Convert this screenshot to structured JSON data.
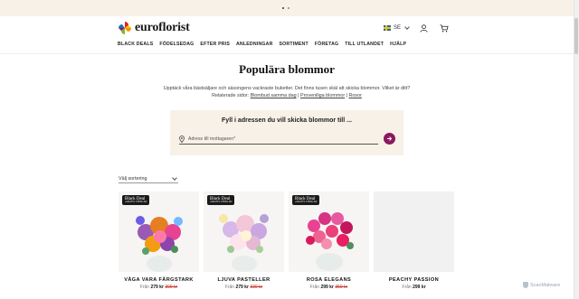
{
  "topbar": {
    "indicator_count": 2
  },
  "header": {
    "logo_text": "euroflorist",
    "language": "SE",
    "nav": [
      "BLACK DEALS",
      "FÖDELSEDAG",
      "EFTER PRIS",
      "ANLEDNINGAR",
      "SORTIMENT",
      "FÖRETAG",
      "TILL UTLANDET",
      "HJÄLP"
    ]
  },
  "page": {
    "title": "Populära blommor",
    "intro": "Upptäck våra bästsäljare och säsongens vackraste buketter. Det finns tusen skäl att skicka blommor. Vilket är ditt?",
    "related_label": "Relaterade sidor:",
    "related_links": [
      "Blombud samma dag",
      "Proveniliga blommor",
      "Rosor"
    ],
    "related_sep": "|"
  },
  "address": {
    "heading": "Fyll i adressen du vill skicka blommor till ...",
    "placeholder": "Adress till mottagaren*"
  },
  "sort": {
    "label": "Välj sortering"
  },
  "products": [
    {
      "name": "VÅGA VARA FÄRGSTARK",
      "from": "Från",
      "price": "279 kr",
      "old_price": "309 kr",
      "badge": "Black Deal",
      "badge_sub": "+GRATIS CHOKLAD"
    },
    {
      "name": "LJUVA PASTELLER",
      "from": "Från",
      "price": "279 kr",
      "old_price": "339 kr",
      "badge": "Black Deal",
      "badge_sub": "+GRATIS CHOKLAD"
    },
    {
      "name": "ROSA ELEGANS",
      "from": "Från",
      "price": "299 kr",
      "old_price": "359 kr",
      "badge": "Black Deal",
      "badge_sub": "+GRATIS CHOKLAD"
    },
    {
      "name": "PEACHY PASSION",
      "from": "Från",
      "price": "299 kr",
      "old_price": "",
      "badge": "",
      "badge_sub": ""
    }
  ],
  "watermark": "ScanMalware",
  "colors": {
    "accent": "#8a1a60",
    "banner_bg": "#f7f1e7",
    "sale": "#c0392b"
  }
}
